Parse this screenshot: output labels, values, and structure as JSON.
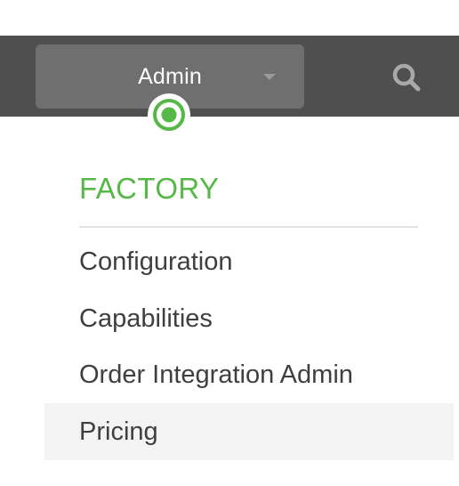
{
  "header": {
    "role_selector": {
      "selected": "Admin"
    },
    "search_icon": "search-icon",
    "location_pin_icon": "location-pin-icon"
  },
  "menu": {
    "section_title": "FACTORY",
    "items": [
      {
        "label": "Configuration",
        "active": false
      },
      {
        "label": "Capabilities",
        "active": false
      },
      {
        "label": "Order Integration Admin",
        "active": false
      },
      {
        "label": "Pricing",
        "active": true
      }
    ]
  },
  "colors": {
    "accent": "#56b947",
    "topbar": "#4f4f4f",
    "selector_bg": "#6f6f6f",
    "active_item_bg": "#f3f3f3",
    "text": "#3f3f3f"
  }
}
